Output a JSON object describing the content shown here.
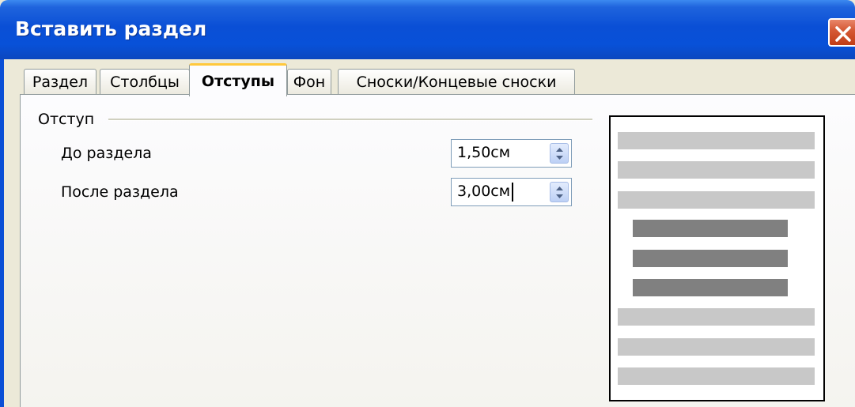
{
  "window": {
    "title": "Вставить раздел"
  },
  "tabs": [
    {
      "label": "Раздел"
    },
    {
      "label": "Столбцы"
    },
    {
      "label": "Отступы"
    },
    {
      "label": "Фон"
    },
    {
      "label": "Сноски/Концевые сноски"
    }
  ],
  "active_tab": "Отступы",
  "indent_group": {
    "title": "Отступ",
    "before": {
      "label": "До раздела",
      "value": "1,50см"
    },
    "after": {
      "label": "После раздела",
      "value": "3,00см"
    }
  },
  "colors": {
    "titlebar": "#0a4fd6",
    "active_tab_accent": "#ffc83c",
    "preview_outer_line": "#c8c8c8",
    "preview_section_line": "#808080"
  },
  "icons": [
    "close-icon",
    "spin-arrows-icon"
  ]
}
